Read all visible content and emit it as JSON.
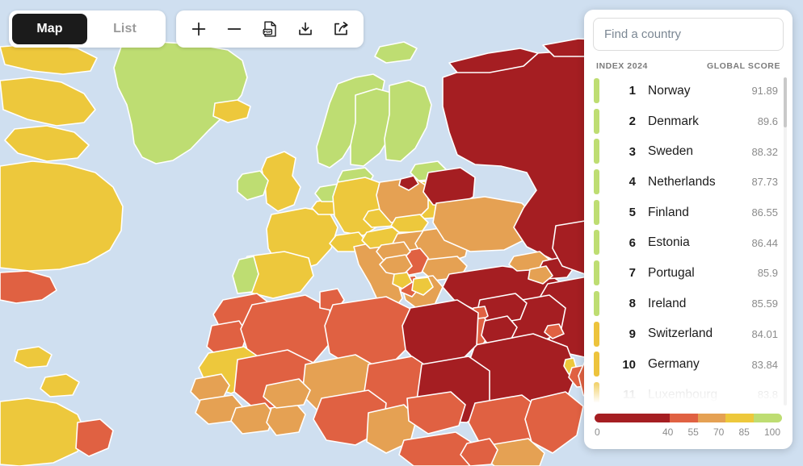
{
  "toolbar": {
    "tabs": [
      {
        "label": "Map",
        "active": true,
        "name": "tab-map"
      },
      {
        "label": "List",
        "active": false,
        "name": "tab-list"
      }
    ],
    "tools": [
      {
        "icon": "plus-icon",
        "title": "Zoom in"
      },
      {
        "icon": "minus-icon",
        "title": "Zoom out"
      },
      {
        "icon": "pdf-icon",
        "title": "Export PDF"
      },
      {
        "icon": "download-icon",
        "title": "Download"
      },
      {
        "icon": "share-icon",
        "title": "Share"
      }
    ]
  },
  "panel": {
    "search": {
      "placeholder": "Find a country",
      "value": ""
    },
    "columns": {
      "index": "INDEX 2024",
      "score": "GLOBAL SCORE"
    },
    "rows": [
      {
        "rank": "1",
        "country": "Norway",
        "score": "91.89",
        "color": "#bedd72"
      },
      {
        "rank": "2",
        "country": "Denmark",
        "score": "89.6",
        "color": "#bedd72"
      },
      {
        "rank": "3",
        "country": "Sweden",
        "score": "88.32",
        "color": "#bedd72"
      },
      {
        "rank": "4",
        "country": "Netherlands",
        "score": "87.73",
        "color": "#bedd72"
      },
      {
        "rank": "5",
        "country": "Finland",
        "score": "86.55",
        "color": "#bedd72"
      },
      {
        "rank": "6",
        "country": "Estonia",
        "score": "86.44",
        "color": "#bedd72"
      },
      {
        "rank": "7",
        "country": "Portugal",
        "score": "85.9",
        "color": "#bedd72"
      },
      {
        "rank": "8",
        "country": "Ireland",
        "score": "85.59",
        "color": "#bedd72"
      },
      {
        "rank": "9",
        "country": "Switzerland",
        "score": "84.01",
        "color": "#edc33c"
      },
      {
        "rank": "10",
        "country": "Germany",
        "score": "83.84",
        "color": "#edc33c"
      },
      {
        "rank": "11",
        "country": "Luxembourg",
        "score": "83.8",
        "color": "#edc33c",
        "faded": true
      }
    ]
  },
  "legend": {
    "bands": [
      {
        "color": "#a51e22",
        "from": 0,
        "to": 40
      },
      {
        "color": "#e06142",
        "from": 40,
        "to": 55
      },
      {
        "color": "#e5a153",
        "from": 55,
        "to": 70
      },
      {
        "color": "#edc83c",
        "from": 70,
        "to": 85
      },
      {
        "color": "#bedd72",
        "from": 85,
        "to": 100
      }
    ],
    "ticks": [
      "0",
      "40",
      "55",
      "70",
      "85",
      "100"
    ]
  },
  "map": {
    "ocean_color": "#cfdff0",
    "border_color": "#ffffff",
    "palette": {
      "very_bad": "#a51e22",
      "bad": "#e06142",
      "problematic": "#e5a153",
      "satisfactory": "#edc83c",
      "good": "#bedd72"
    }
  }
}
